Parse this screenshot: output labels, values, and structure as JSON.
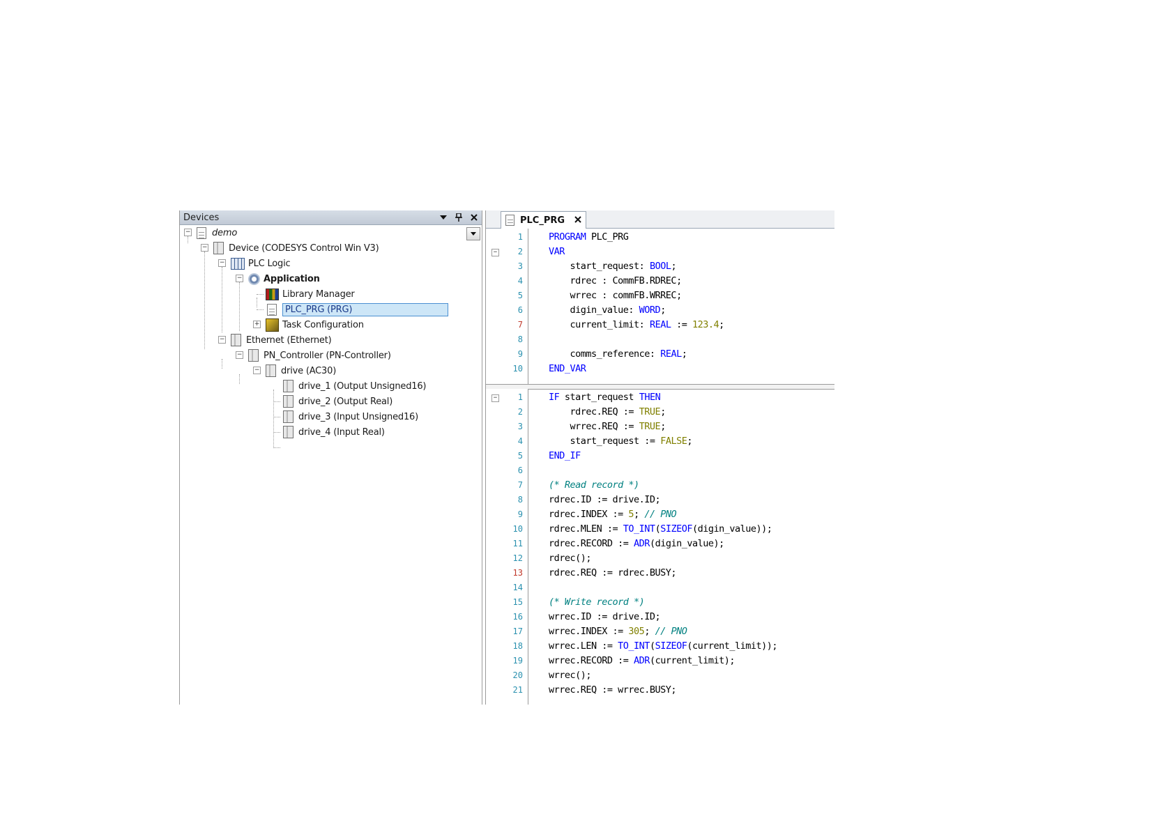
{
  "devices_panel": {
    "title": "Devices",
    "pin_icon": "pin-icon",
    "close_icon": "close-icon",
    "tree": {
      "root": "demo",
      "device": "Device (CODESYS Control Win V3)",
      "plc_logic": "PLC Logic",
      "application": "Application",
      "library_manager": "Library Manager",
      "plc_prg": "PLC_PRG (PRG)",
      "task_configuration": "Task Configuration",
      "ethernet": "Ethernet (Ethernet)",
      "pn_controller": "PN_Controller (PN-Controller)",
      "drive": "drive (AC30)",
      "drive_1": "drive_1 (Output Unsigned16)",
      "drive_2": "drive_2 (Output Real)",
      "drive_3": "drive_3 (Input Unsigned16)",
      "drive_4": "drive_4 (Input Real)"
    }
  },
  "editor": {
    "tab_label": "PLC_PRG",
    "declarations": [
      {
        "n": "1",
        "html": "<span class='kw'>PROGRAM</span> PLC_PRG"
      },
      {
        "n": "2",
        "html": "<span class='kw'>VAR</span>"
      },
      {
        "n": "3",
        "html": "    start_request: <span class='ty'>BOOL</span>;"
      },
      {
        "n": "4",
        "html": "    rdrec : CommFB.RDREC;"
      },
      {
        "n": "5",
        "html": "    wrrec : commFB.WRREC;"
      },
      {
        "n": "6",
        "html": "    digin_value: <span class='ty'>WORD</span>;"
      },
      {
        "n": "7",
        "html": "    current_limit: <span class='ty'>REAL</span> := <span class='lit'>123.4</span>;"
      },
      {
        "n": "8",
        "html": ""
      },
      {
        "n": "9",
        "html": "    comms_reference: <span class='ty'>REAL</span>;"
      },
      {
        "n": "10",
        "html": "<span class='kw'>END_VAR</span>"
      }
    ],
    "body": [
      {
        "n": "1",
        "html": "<span class='kw'>IF</span> start_request <span class='kw'>THEN</span>"
      },
      {
        "n": "2",
        "html": "    rdrec.REQ := <span class='lit'>TRUE</span>;"
      },
      {
        "n": "3",
        "html": "    wrrec.REQ := <span class='lit'>TRUE</span>;"
      },
      {
        "n": "4",
        "html": "    start_request := <span class='lit'>FALSE</span>;"
      },
      {
        "n": "5",
        "html": "<span class='kw'>END_IF</span>"
      },
      {
        "n": "6",
        "html": ""
      },
      {
        "n": "7",
        "html": "<span class='cm'>(* Read record *)</span>"
      },
      {
        "n": "8",
        "html": "rdrec.ID := drive.ID;"
      },
      {
        "n": "9",
        "html": "rdrec.INDEX := <span class='lit'>5</span>; <span class='cm'>// PNO</span>"
      },
      {
        "n": "10",
        "html": "rdrec.MLEN := <span class='kw'>TO_INT</span>(<span class='kw'>SIZEOF</span>(digin_value));"
      },
      {
        "n": "11",
        "html": "rdrec.RECORD := <span class='kw'>ADR</span>(digin_value);"
      },
      {
        "n": "12",
        "html": "rdrec();"
      },
      {
        "n": "13",
        "html": "rdrec.REQ := rdrec.BUSY;"
      },
      {
        "n": "14",
        "html": ""
      },
      {
        "n": "15",
        "html": "<span class='cm'>(* Write record *)</span>"
      },
      {
        "n": "16",
        "html": "wrrec.ID := drive.ID;"
      },
      {
        "n": "17",
        "html": "wrrec.INDEX := <span class='lit'>305</span>; <span class='cm'>// PNO</span>"
      },
      {
        "n": "18",
        "html": "wrrec.LEN := <span class='kw'>TO_INT</span>(<span class='kw'>SIZEOF</span>(current_limit));"
      },
      {
        "n": "19",
        "html": "wrrec.RECORD := <span class='kw'>ADR</span>(current_limit);"
      },
      {
        "n": "20",
        "html": "wrrec();"
      },
      {
        "n": "21",
        "html": "wrrec.REQ := wrrec.BUSY;"
      }
    ]
  },
  "colors": {
    "keyword": "#0000ff",
    "literal": "#808000",
    "comment": "#008080",
    "line_number": "#2b91af",
    "selection": "#cde6f7"
  }
}
